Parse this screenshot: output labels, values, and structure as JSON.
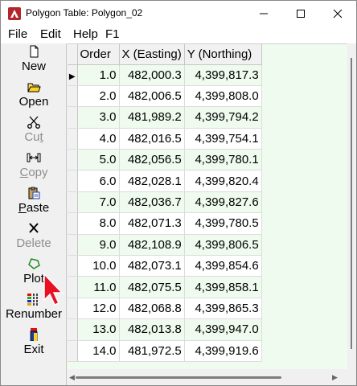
{
  "window": {
    "title": "Polygon Table: Polygon_02",
    "minimize_glyph": "—",
    "maximize_glyph": "☐",
    "close_glyph": "✕"
  },
  "menu": [
    {
      "label": "File"
    },
    {
      "label": "Edit"
    },
    {
      "label": "Help"
    },
    {
      "label": "F1"
    }
  ],
  "toolbar": [
    {
      "label": "New",
      "icon": "new-document-icon",
      "enabled": true
    },
    {
      "label": "Open",
      "icon": "open-folder-icon",
      "enabled": true
    },
    {
      "label": "Cut",
      "icon": "scissors-icon",
      "enabled": false
    },
    {
      "label": "Copy",
      "icon": "copy-icon",
      "enabled": false
    },
    {
      "label": "Paste",
      "icon": "paste-clipboard-icon",
      "enabled": true
    },
    {
      "label": "Delete",
      "icon": "delete-x-icon",
      "enabled": false
    },
    {
      "label": "Plot",
      "icon": "polygon-plot-icon",
      "enabled": true
    },
    {
      "label": "Renumber",
      "icon": "renumber-icon",
      "enabled": true
    },
    {
      "label": "Exit",
      "icon": "exit-icon",
      "enabled": true
    }
  ],
  "table": {
    "columns": [
      "Order",
      "X (Easting)",
      "Y (Northing)"
    ],
    "current_row_indicator": "▶",
    "rows": [
      [
        "1.0",
        "482,000.3",
        "4,399,817.3"
      ],
      [
        "2.0",
        "482,006.5",
        "4,399,808.0"
      ],
      [
        "3.0",
        "481,989.2",
        "4,399,794.2"
      ],
      [
        "4.0",
        "482,016.5",
        "4,399,754.1"
      ],
      [
        "5.0",
        "482,056.5",
        "4,399,780.1"
      ],
      [
        "6.0",
        "482,028.1",
        "4,399,820.4"
      ],
      [
        "7.0",
        "482,036.7",
        "4,399,827.6"
      ],
      [
        "8.0",
        "482,071.3",
        "4,399,780.5"
      ],
      [
        "9.0",
        "482,108.9",
        "4,399,806.5"
      ],
      [
        "10.0",
        "482,073.1",
        "4,399,854.6"
      ],
      [
        "11.0",
        "482,075.5",
        "4,399,858.1"
      ],
      [
        "12.0",
        "482,068.8",
        "4,399,865.3"
      ],
      [
        "13.0",
        "482,013.8",
        "4,399,947.0"
      ],
      [
        "14.0",
        "481,972.5",
        "4,399,919.6"
      ]
    ]
  },
  "colors": {
    "grid_alt_row": "#eefbee",
    "grid_background": "#eefbee",
    "cursor_red": "#e81123"
  }
}
